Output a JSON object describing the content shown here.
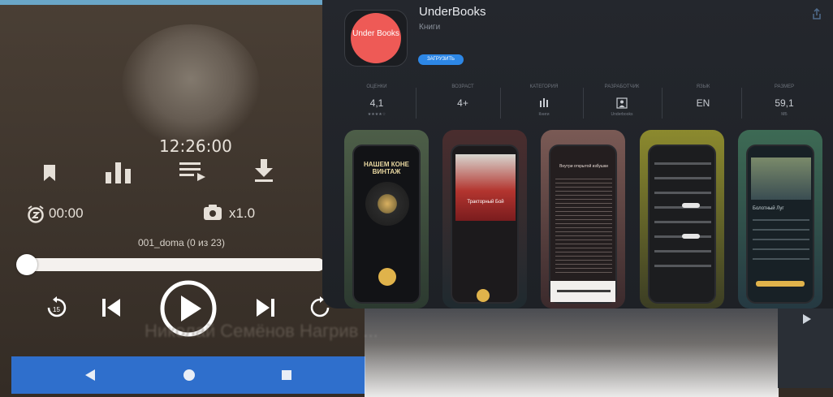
{
  "player": {
    "clock": "12:26:00",
    "sleep_timer": "00:00",
    "speed": "x1.0",
    "track_name": "001_doma (0 из 23)",
    "progress": 0.02,
    "blurred_title": "Николай Семёнов Нагрив ...",
    "colors": {
      "accent": "#2f6fcc",
      "background": "#3d342c"
    }
  },
  "store": {
    "app_name": "UnderBooks",
    "app_category": "Книги",
    "app_icon_text": "Under Books",
    "get_label": "ЗАГРУЗИТЬ",
    "stats": [
      {
        "label": "ОЦЕНКИ",
        "value": "4,1",
        "sub": "★★★★☆"
      },
      {
        "label": "ВОЗРАСТ",
        "value": "4+",
        "sub": ""
      },
      {
        "label": "КАТЕГОРИЯ",
        "value": "📊",
        "sub": "Книги"
      },
      {
        "label": "РАЗРАБОТЧИК",
        "value": "👤",
        "sub": "Underbooks"
      },
      {
        "label": "ЯЗЫК",
        "value": "EN",
        "sub": ""
      },
      {
        "label": "РАЗМЕР",
        "value": "59,1",
        "sub": "МБ"
      }
    ],
    "screenshots": [
      {
        "title": "НАШЕМ КОНЕ ВИНТАЖ",
        "caption": "",
        "bg": "#3a4a3d"
      },
      {
        "title": "Тракторный Бой",
        "caption": "",
        "bg": "#4a2a2e"
      },
      {
        "title": "Внутри открытой избушки",
        "caption": "",
        "bg": "#5a4642"
      },
      {
        "title": "",
        "caption": "",
        "bg": "#5a5a2a"
      },
      {
        "title": "Болотный Луг",
        "caption": "",
        "bg": "#2e4a52"
      }
    ],
    "colors": {
      "get_button": "#2d87e6",
      "icon_red": "#ee5a56"
    }
  }
}
